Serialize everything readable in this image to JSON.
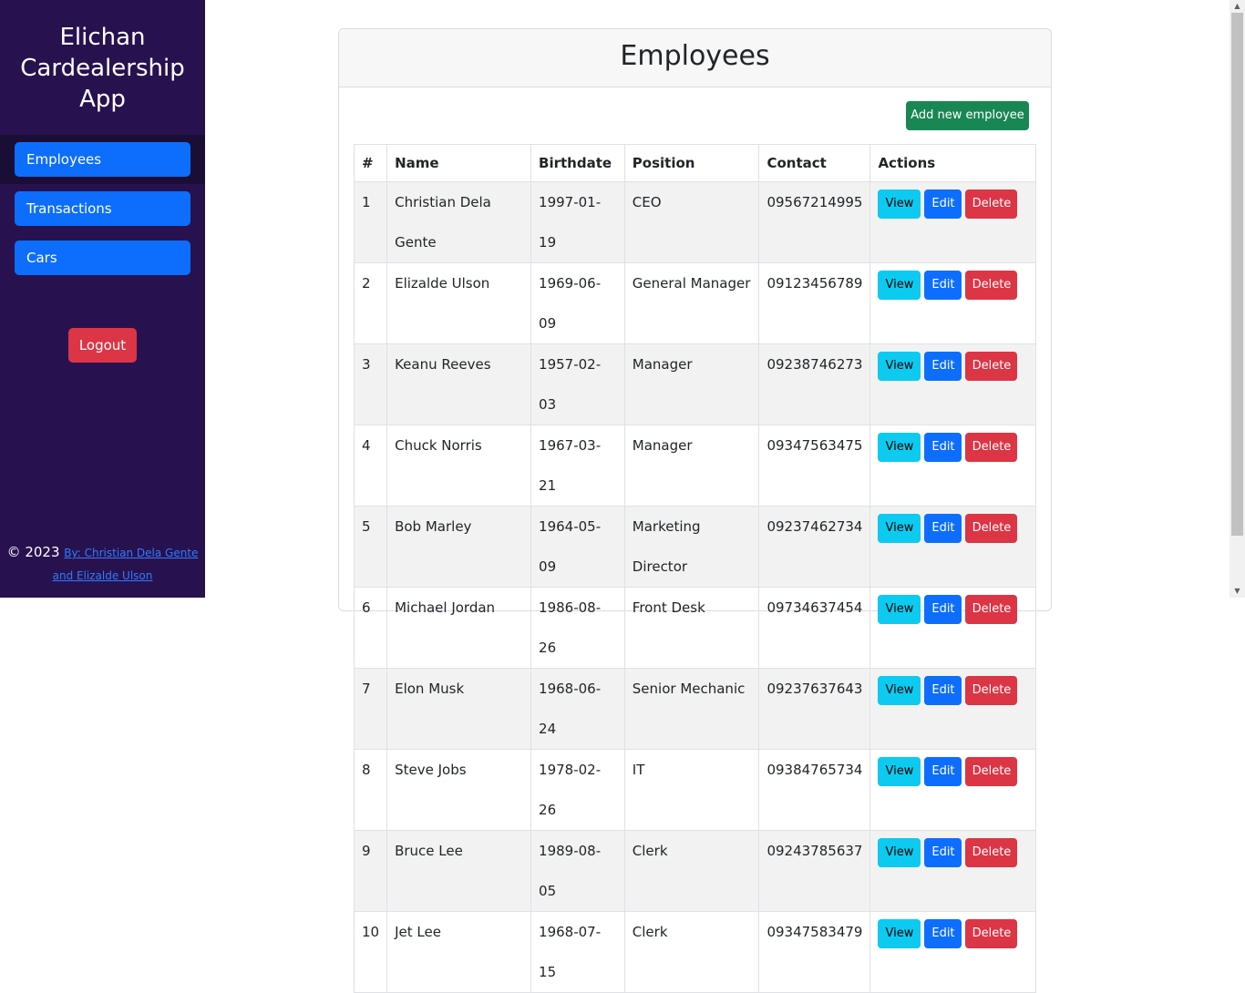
{
  "sidebar": {
    "title_lines": [
      "Elichan",
      "Cardealership",
      "App"
    ],
    "nav": [
      {
        "label": "Employees"
      },
      {
        "label": "Transactions"
      },
      {
        "label": "Cars"
      }
    ],
    "logout_label": "Logout",
    "footer": {
      "prefix": "© 2023",
      "link_text": "By: Christian Dela Gente and Elizalde Ulson"
    }
  },
  "main": {
    "title": "Employees",
    "add_button": "Add new employee",
    "columns": [
      "#",
      "Name",
      "Birthdate",
      "Position",
      "Contact",
      "Actions"
    ],
    "actions": {
      "view": "View",
      "edit": "Edit",
      "delete": "Delete"
    },
    "rows": [
      {
        "id": "1",
        "name": "Christian Dela Gente",
        "birthdate": "1997-01-19",
        "position": "CEO",
        "contact": "09567214995"
      },
      {
        "id": "2",
        "name": "Elizalde Ulson",
        "birthdate": "1969-06-09",
        "position": "General Manager",
        "contact": "09123456789"
      },
      {
        "id": "3",
        "name": "Keanu Reeves",
        "birthdate": "1957-02-03",
        "position": "Manager",
        "contact": "09238746273"
      },
      {
        "id": "4",
        "name": "Chuck Norris",
        "birthdate": "1967-03-21",
        "position": "Manager",
        "contact": "09347563475"
      },
      {
        "id": "5",
        "name": "Bob Marley",
        "birthdate": "1964-05-09",
        "position": "Marketing Director",
        "contact": "09237462734"
      },
      {
        "id": "6",
        "name": "Michael Jordan",
        "birthdate": "1986-08-26",
        "position": "Front Desk",
        "contact": "09734637454"
      },
      {
        "id": "7",
        "name": "Elon Musk",
        "birthdate": "1968-06-24",
        "position": "Senior Mechanic",
        "contact": "09237637643"
      },
      {
        "id": "8",
        "name": "Steve Jobs",
        "birthdate": "1978-02-26",
        "position": "IT",
        "contact": "09384765734"
      },
      {
        "id": "9",
        "name": "Bruce Lee",
        "birthdate": "1989-08-05",
        "position": "Clerk",
        "contact": "09243785637"
      },
      {
        "id": "10",
        "name": "Jet Lee",
        "birthdate": "1968-07-15",
        "position": "Clerk",
        "contact": "09347583479"
      }
    ]
  }
}
